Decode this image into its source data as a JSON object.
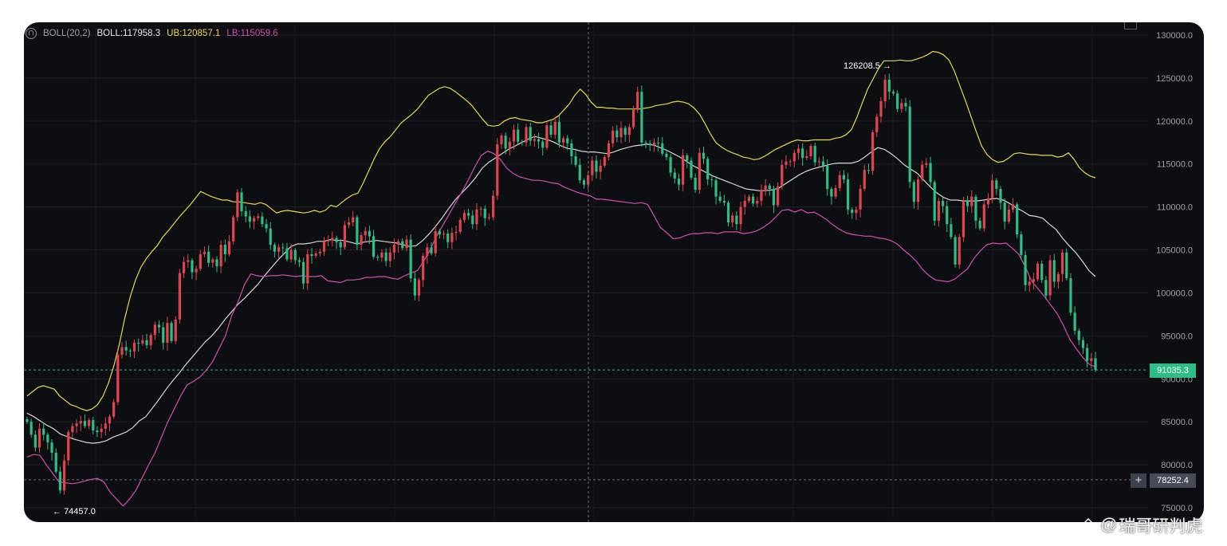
{
  "indicator_bar": {
    "name": "BOLL(20,2)",
    "boll": "BOLL:117958.3",
    "ub": "UB:120857.1",
    "lb": "LB:115059.6"
  },
  "price_tags": {
    "last_price": "91035.3",
    "crosshair_price": "78252.4"
  },
  "annotations": {
    "high": "126208.5",
    "low": "74457.0"
  },
  "watermark": {
    "at": "@",
    "text": "瑞哥研判虎"
  },
  "colors": {
    "background": "#0d0e11",
    "up": "#e0454b",
    "down": "#2ebd85",
    "ub": "#e8d94a",
    "boll": "#d6d6d6",
    "lb": "#d64bb0",
    "last_price_tag": "#2ebd85",
    "crosshair_tag": "#454c58"
  },
  "chart_data": {
    "type": "candlestick",
    "indicator": "BOLL(20,2)",
    "y_axis": {
      "ticks": [
        130000.0,
        125000.0,
        120000.0,
        115000.0,
        110000.0,
        105000.0,
        100000.0,
        95000.0,
        90000.0,
        85000.0,
        80000.0,
        75000.0
      ],
      "range": [
        74000,
        131000
      ]
    },
    "close": [
      85000,
      83500,
      82000,
      84200,
      83500,
      82600,
      81400,
      79200,
      77000,
      80500,
      83800,
      84500,
      84800,
      85100,
      84500,
      85200,
      84000,
      83800,
      84200,
      84800,
      85600,
      87300,
      92800,
      93700,
      93300,
      93200,
      94200,
      94100,
      94500,
      93900,
      95100,
      96300,
      96000,
      94200,
      96500,
      94400,
      96900,
      102300,
      103600,
      103800,
      102400,
      102800,
      104500,
      104800,
      103500,
      103900,
      103100,
      105600,
      104500,
      106000,
      108800,
      111700,
      109500,
      108900,
      108300,
      108700,
      108900,
      108000,
      107500,
      105600,
      104800,
      105300,
      105200,
      103900,
      105000,
      103800,
      103600,
      101100,
      104500,
      104300,
      104600,
      104800,
      106000,
      106100,
      106400,
      105900,
      105300,
      107900,
      108200,
      108800,
      105600,
      106700,
      107200,
      106600,
      104200,
      104100,
      104700,
      103700,
      104700,
      105600,
      106000,
      105200,
      106200,
      101700,
      99700,
      101500,
      104300,
      105300,
      104600,
      107200,
      106800,
      106900,
      105900,
      107000,
      107100,
      108500,
      109300,
      109000,
      108000,
      109700,
      109800,
      108700,
      108800,
      111300,
      117300,
      118300,
      116800,
      117600,
      119000,
      117600,
      117500,
      119300,
      117700,
      117900,
      117600,
      116900,
      119500,
      118400,
      119900,
      117500,
      118000,
      117400,
      115900,
      114900,
      113100,
      112600,
      113700,
      115400,
      114100,
      114800,
      115800,
      117400,
      118900,
      118100,
      119200,
      118400,
      119300,
      121300,
      123400,
      117500,
      117400,
      117200,
      117500,
      117400,
      116200,
      115800,
      114000,
      113300,
      112600,
      116000,
      115400,
      113400,
      112000,
      116300,
      115600,
      113200,
      113100,
      111200,
      110700,
      110500,
      108200,
      109000,
      108000,
      110000,
      110700,
      111200,
      110400,
      110700,
      112000,
      112500,
      112100,
      110200,
      112400,
      114900,
      115300,
      115300,
      116300,
      116800,
      115700,
      115900,
      117100,
      115200,
      115300,
      114800,
      112100,
      111200,
      112200,
      113700,
      113200,
      109700,
      109300,
      109700,
      112100,
      114300,
      114200,
      118700,
      120500,
      122300,
      124800,
      123400,
      123200,
      121400,
      122100,
      121700,
      112900,
      110600,
      113200,
      114900,
      115100,
      112900,
      108400,
      110700,
      110100,
      108000,
      106500,
      103300,
      106500,
      110700,
      110100,
      111200,
      108400,
      107500,
      110300,
      111000,
      113100,
      112100,
      110500,
      108300,
      109700,
      110300,
      106800,
      104400,
      100900,
      101300,
      101600,
      103400,
      101500,
      99700,
      103800,
      101300,
      102200,
      104700,
      101700,
      97700,
      95600,
      94500,
      93600,
      92100,
      92400,
      91035.3
    ],
    "ub": [
      88000,
      88500,
      89000,
      89200,
      89000,
      88800,
      88000,
      87500,
      87000,
      86800,
      86500,
      86300,
      86500,
      87000,
      88000,
      89500,
      91500,
      94000,
      97000,
      99500,
      101500,
      103000,
      104000,
      104800,
      105500,
      106500,
      107200,
      108000,
      108800,
      109500,
      110200,
      111000,
      111800,
      111500,
      111200,
      111000,
      110800,
      110800,
      110600,
      110600,
      110500,
      110400,
      110300,
      110500,
      110300,
      109800,
      109300,
      109500,
      109600,
      109500,
      109400,
      109300,
      109400,
      109600,
      109400,
      109600,
      110200,
      110000,
      110500,
      111000,
      111400,
      111600,
      112800,
      114200,
      115600,
      116800,
      117600,
      118200,
      119000,
      119800,
      120300,
      120800,
      121400,
      122200,
      123000,
      123400,
      123800,
      124000,
      123800,
      123400,
      122900,
      122400,
      121800,
      121000,
      120200,
      119500,
      119400,
      119500,
      120000,
      120300,
      120400,
      120200,
      120100,
      120000,
      119800,
      119800,
      120000,
      120200,
      120600,
      121300,
      122000,
      123000,
      123700,
      123100,
      122200,
      121600,
      121600,
      121500,
      121500,
      121400,
      121400,
      121400,
      121400,
      121400,
      121500,
      121600,
      121800,
      121900,
      122000,
      122200,
      122300,
      122200,
      122000,
      121500,
      120800,
      119700,
      118500,
      117500,
      117000,
      116600,
      116300,
      116100,
      115800,
      115700,
      115500,
      115600,
      115900,
      116300,
      116700,
      117000,
      117300,
      117600,
      117800,
      117700,
      117700,
      117800,
      117800,
      117800,
      117800,
      118000,
      118100,
      118400,
      119000,
      120400,
      122100,
      123700,
      124900,
      126100,
      127000,
      127000,
      127000,
      127100,
      127000,
      127000,
      127200,
      127400,
      127700,
      128100,
      128000,
      127700,
      127100,
      125800,
      124100,
      122400,
      120600,
      118800,
      117100,
      116100,
      115500,
      115200,
      115300,
      115700,
      116200,
      116300,
      116200,
      116100,
      116100,
      116000,
      116000,
      116000,
      115800,
      115900,
      116300,
      115600,
      114600,
      114000,
      113600,
      113400
    ],
    "mid": [
      86000,
      85600,
      85100,
      84600,
      84200,
      83600,
      83300,
      83000,
      82800,
      82600,
      82500,
      82600,
      82800,
      83200,
      83500,
      83800,
      84300,
      85100,
      85600,
      86600,
      87600,
      88700,
      89700,
      90600,
      91600,
      92500,
      93400,
      94300,
      95000,
      95900,
      96900,
      97800,
      98700,
      99400,
      100200,
      101000,
      102000,
      102900,
      103800,
      104600,
      105400,
      105700,
      105700,
      105800,
      106000,
      106000,
      106200,
      106100,
      106100,
      105900,
      105700,
      105900,
      106000,
      106100,
      106000,
      105900,
      105800,
      105600,
      105400,
      105500,
      106100,
      106900,
      107800,
      108800,
      109900,
      110900,
      111700,
      112500,
      113400,
      114500,
      115200,
      115700,
      116200,
      116700,
      117100,
      117500,
      117900,
      118200,
      118000,
      117800,
      117500,
      117100,
      116800,
      116700,
      116500,
      116400,
      116400,
      116300,
      116200,
      116400,
      116700,
      116900,
      117100,
      117200,
      117300,
      117200,
      116900,
      116600,
      116200,
      115800,
      115300,
      114800,
      114400,
      114000,
      113600,
      113300,
      113000,
      112700,
      112400,
      112100,
      112000,
      111900,
      111900,
      112000,
      112200,
      112700,
      113200,
      113700,
      114100,
      114400,
      114600,
      114800,
      115000,
      115100,
      115100,
      115100,
      115300,
      115800,
      116400,
      116900,
      116700,
      116200,
      115600,
      114900,
      114400,
      113900,
      113100,
      112300,
      111600,
      111100,
      110800,
      110800,
      110700,
      110700,
      110700,
      110800,
      110900,
      111000,
      110800,
      110400,
      109900,
      109500,
      109000,
      108900,
      108700,
      108000,
      107400,
      106400,
      105500,
      104700,
      103700,
      102600,
      101900
    ],
    "lb": [
      80900,
      81200,
      81100,
      80000,
      79000,
      78000,
      77900,
      77800,
      77900,
      78100,
      78300,
      78400,
      78000,
      76800,
      76000,
      75200,
      76000,
      77000,
      78500,
      80000,
      81400,
      83200,
      85000,
      86500,
      88000,
      89300,
      89700,
      90200,
      91000,
      92000,
      93500,
      95000,
      97400,
      99000,
      101000,
      102200,
      102000,
      101900,
      102000,
      102000,
      102100,
      102000,
      101900,
      102000,
      101900,
      101900,
      102000,
      101400,
      101300,
      101200,
      101500,
      101500,
      101600,
      101800,
      101800,
      101900,
      101900,
      101700,
      101600,
      102000,
      102300,
      102600,
      103700,
      105000,
      106600,
      107900,
      109200,
      110500,
      111800,
      113200,
      114700,
      116000,
      116500,
      116200,
      115500,
      114500,
      113900,
      113500,
      113300,
      113100,
      113100,
      113000,
      112800,
      112700,
      112300,
      112000,
      111700,
      111500,
      111300,
      110900,
      110900,
      110800,
      110700,
      110600,
      110500,
      110400,
      110500,
      110300,
      109000,
      107600,
      107000,
      106300,
      106400,
      106700,
      106900,
      106900,
      107000,
      107000,
      106900,
      107100,
      107100,
      107100,
      106900,
      107000,
      107200,
      107600,
      108100,
      108800,
      109600,
      109700,
      109400,
      109700,
      109300,
      109400,
      109000,
      108500,
      107900,
      107400,
      107000,
      106800,
      106700,
      106600,
      106600,
      106400,
      106300,
      106100,
      105700,
      105000,
      104400,
      103700,
      102700,
      102000,
      101500,
      101400,
      101300,
      101600,
      102200,
      102800,
      104000,
      104900,
      105600,
      105800,
      105700,
      105800,
      105200,
      104500,
      103100,
      101400,
      100500,
      99600,
      98600,
      97600,
      96200,
      94600,
      93500,
      92500,
      91700,
      91400
    ]
  }
}
